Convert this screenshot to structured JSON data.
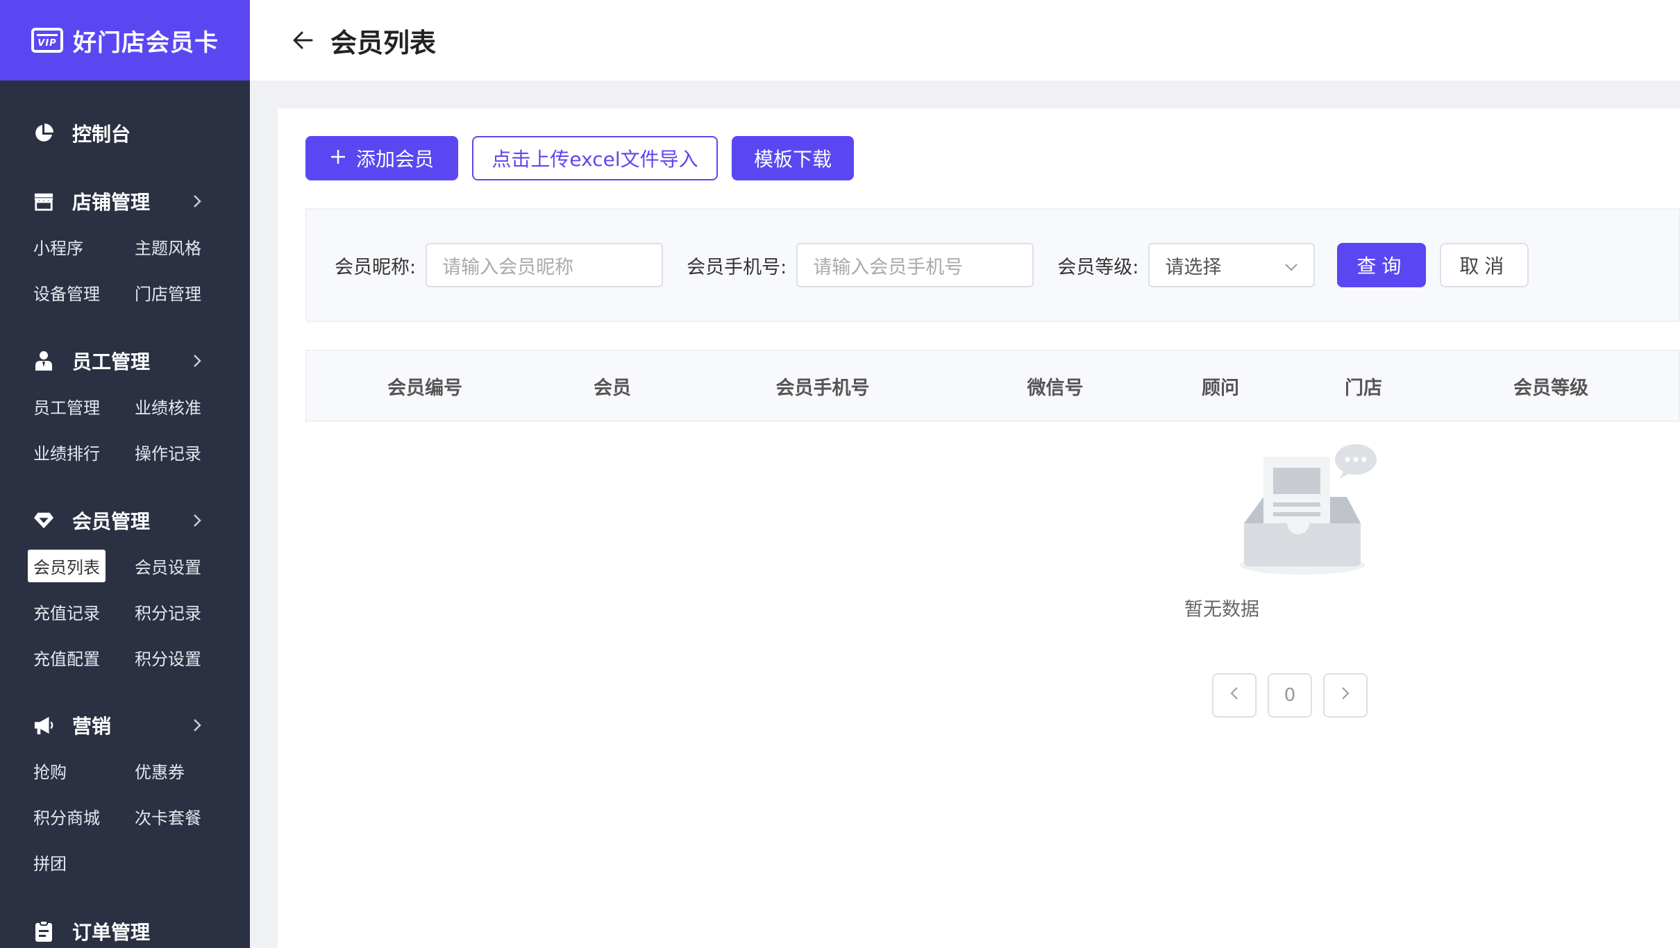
{
  "brand": {
    "badge": "VIP",
    "name": "好门店会员卡",
    "color": "#5b47f2"
  },
  "header": {
    "title": "会员列表"
  },
  "sidebar": {
    "dashboard": {
      "label": "控制台",
      "icon": "pie-chart-icon"
    },
    "groups": [
      {
        "title": "店铺管理",
        "icon": "store-icon",
        "items": [
          "小程序",
          "主题风格",
          "设备管理",
          "门店管理"
        ]
      },
      {
        "title": "员工管理",
        "icon": "staff-icon",
        "items": [
          "员工管理",
          "业绩核准",
          "业绩排行",
          "操作记录"
        ]
      },
      {
        "title": "会员管理",
        "icon": "diamond-icon",
        "items": [
          "会员列表",
          "会员设置",
          "充值记录",
          "积分记录",
          "充值配置",
          "积分设置"
        ],
        "active": "会员列表"
      },
      {
        "title": "营销",
        "icon": "megaphone-icon",
        "items": [
          "抢购",
          "优惠券",
          "积分商城",
          "次卡套餐",
          "拼团"
        ]
      },
      {
        "title": "订单管理",
        "icon": "clipboard-icon",
        "items": []
      }
    ]
  },
  "toolbar": {
    "add_label": "添加会员",
    "upload_label": "点击上传excel文件导入",
    "template_label": "模板下载"
  },
  "filter": {
    "nickname_label": "会员昵称:",
    "nickname_placeholder": "请输入会员昵称",
    "phone_label": "会员手机号:",
    "phone_placeholder": "请输入会员手机号",
    "level_label": "会员等级:",
    "level_value": "请选择",
    "query_label": "查询",
    "cancel_label": "取消"
  },
  "table": {
    "columns": [
      "会员编号",
      "会员",
      "会员手机号",
      "微信号",
      "顾问",
      "门店",
      "会员等级"
    ],
    "rows": [],
    "empty_text": "暂无数据"
  },
  "pagination": {
    "current": "0"
  }
}
